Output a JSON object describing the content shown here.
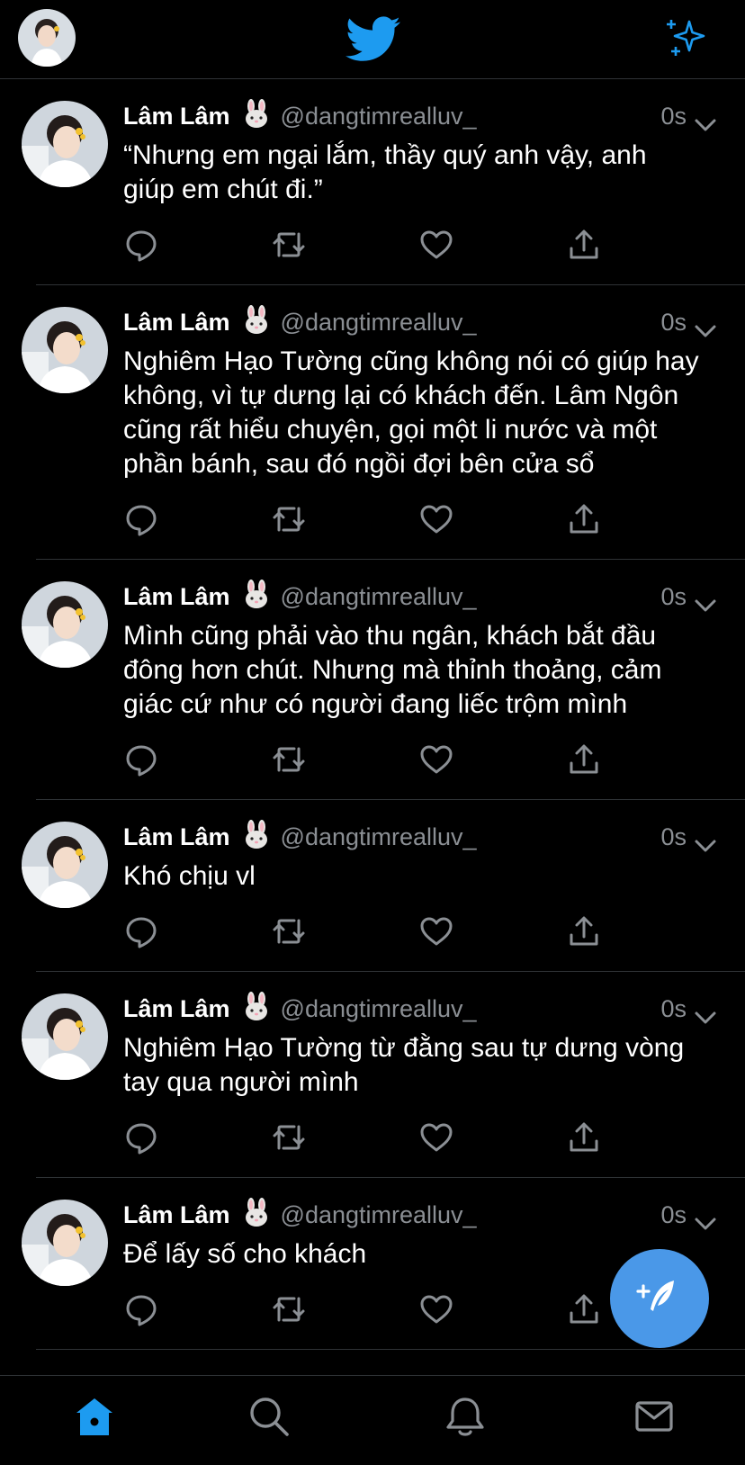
{
  "header": {
    "accent_color": "#1d9bf0",
    "logo_icon": "twitter-bird-icon",
    "right_icon": "sparkle-icon"
  },
  "tweets": [
    {
      "name": "Lâm Lâm",
      "emoji": "rabbit-face",
      "handle": "@dangtimrealluv_",
      "time": "0s",
      "text": "“Nhưng em ngại lắm, thầy quý anh vậy, anh giúp em chút đi.”"
    },
    {
      "name": "Lâm Lâm",
      "emoji": "rabbit-face",
      "handle": "@dangtimrealluv_",
      "time": "0s",
      "text": "Nghiêm Hạo Tường cũng không nói có giúp hay không, vì tự dưng lại có khách đến. Lâm Ngôn cũng rất hiểu chuyện, gọi một li nước và một phần bánh, sau đó ngồi đợi bên cửa sổ"
    },
    {
      "name": "Lâm Lâm",
      "emoji": "rabbit-face",
      "handle": "@dangtimrealluv_",
      "time": "0s",
      "text": "Mình cũng phải vào thu ngân, khách bắt đầu đông hơn chút. Nhưng mà thỉnh thoảng, cảm giác cứ như có người đang liếc trộm mình"
    },
    {
      "name": "Lâm Lâm",
      "emoji": "rabbit-face",
      "handle": "@dangtimrealluv_",
      "time": "0s",
      "text": "Khó chịu vl"
    },
    {
      "name": "Lâm Lâm",
      "emoji": "rabbit-face",
      "handle": "@dangtimrealluv_",
      "time": "0s",
      "text": "Nghiêm Hạo Tường từ đằng sau tự dưng vòng tay qua người mình"
    },
    {
      "name": "Lâm Lâm",
      "emoji": "rabbit-face",
      "handle": "@dangtimrealluv_",
      "time": "0s",
      "text": "Để lấy số cho khách"
    }
  ],
  "fab": {
    "icon": "compose-tweet-icon",
    "color": "#4a98e8"
  },
  "tabbar": {
    "items": [
      "home-icon",
      "search-icon",
      "notifications-icon",
      "messages-icon"
    ],
    "active_color": "#1d9bf0"
  }
}
